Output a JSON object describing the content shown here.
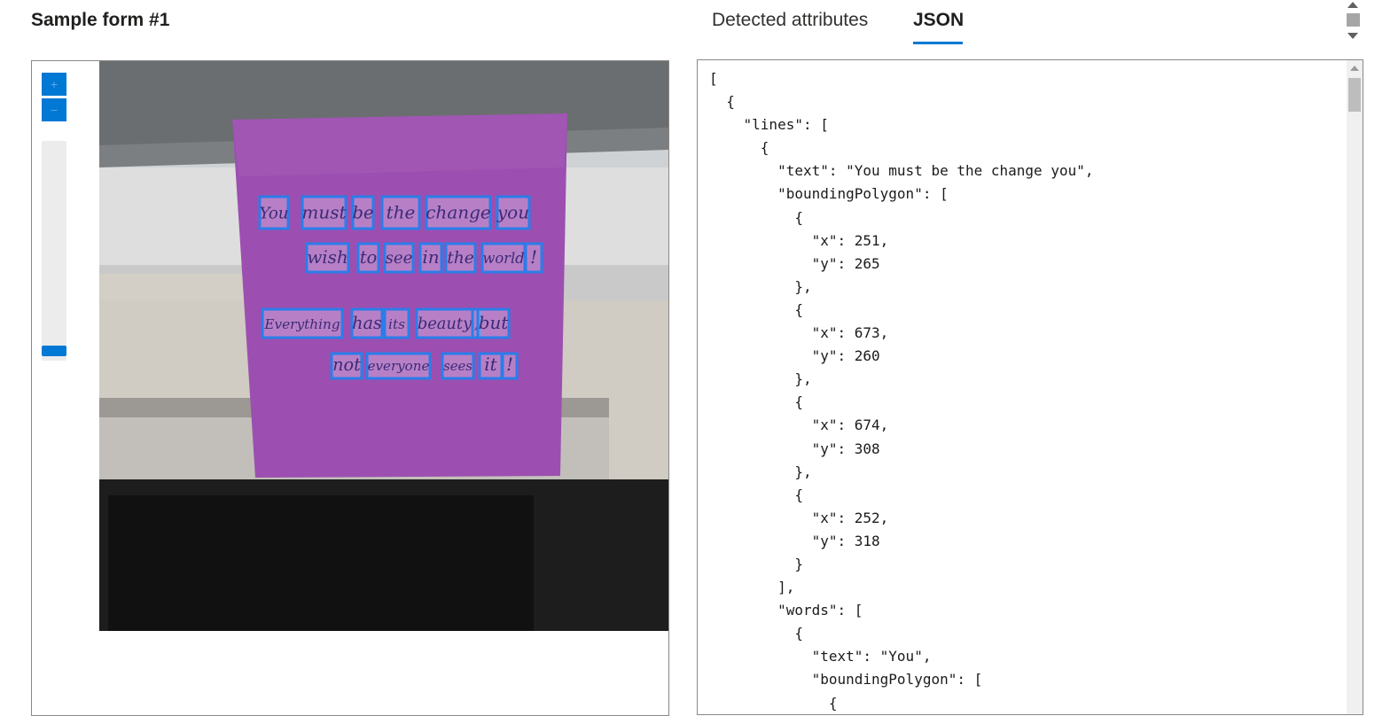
{
  "form": {
    "title": "Sample form #1"
  },
  "tabs": [
    {
      "label": "Detected attributes",
      "selected": false
    },
    {
      "label": "JSON",
      "selected": true
    }
  ],
  "viewer": {
    "zoom_in_label": "+",
    "zoom_out_label": "−",
    "zoom_level_fraction": 0.98,
    "recognized_words": [
      "You",
      "must",
      "be",
      "the",
      "change",
      "you",
      "wish",
      "to",
      "see",
      "in",
      "the",
      "world",
      "!",
      "Everything",
      "has",
      "its",
      "beauty",
      ",",
      "but",
      "not",
      "everyone",
      "sees",
      "it",
      "!"
    ]
  },
  "json_view": {
    "text": "[\n  {\n    \"lines\": [\n      {\n        \"text\": \"You must be the change you\",\n        \"boundingPolygon\": [\n          {\n            \"x\": 251,\n            \"y\": 265\n          },\n          {\n            \"x\": 673,\n            \"y\": 260\n          },\n          {\n            \"x\": 674,\n            \"y\": 308\n          },\n          {\n            \"x\": 252,\n            \"y\": 318\n          }\n        ],\n        \"words\": [\n          {\n            \"text\": \"You\",\n            \"boundingPolygon\": [\n              {"
  },
  "colors": {
    "accent": "#0078d4",
    "sticky_note": "#9c4fb0",
    "box_outline": "#2b7de9"
  }
}
